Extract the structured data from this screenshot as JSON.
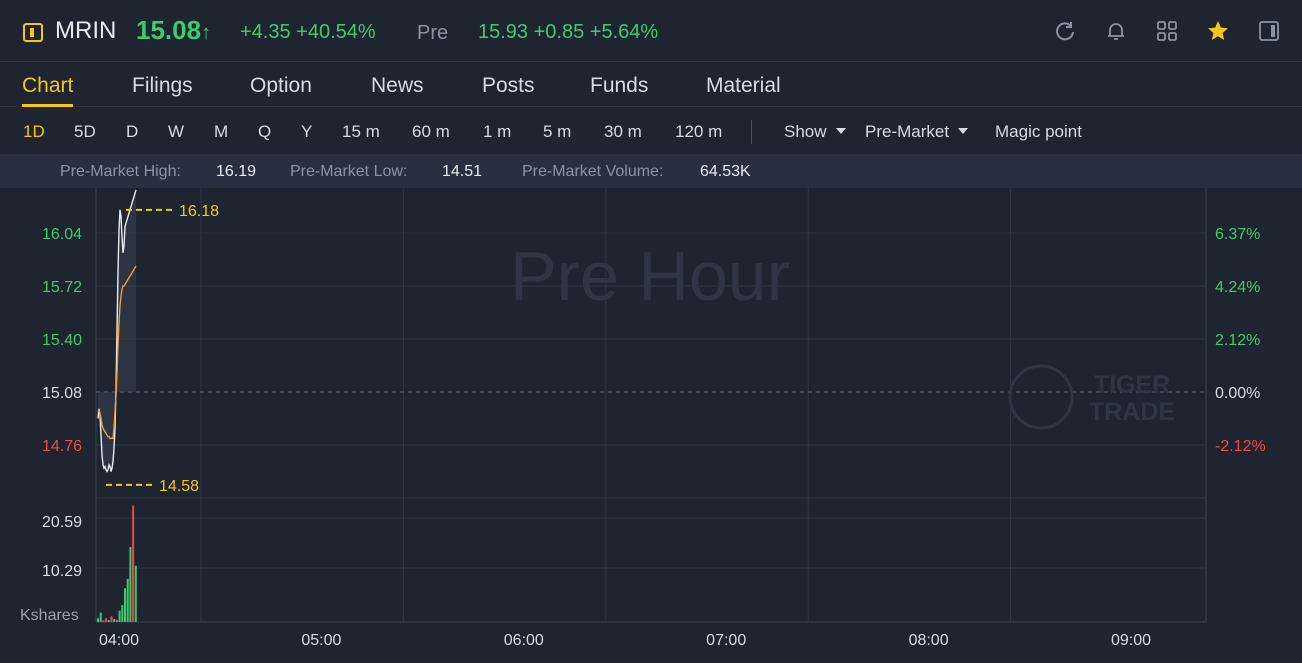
{
  "header": {
    "symbol": "MRIN",
    "price": "15.08",
    "price_arrow": "↑",
    "change": "+4.35 +40.54%",
    "pre_label": "Pre",
    "pre_values": "15.93 +0.85 +5.64%",
    "icons": [
      "refresh-icon",
      "bell-icon",
      "grid-icon",
      "star-icon",
      "panel-icon"
    ]
  },
  "tabs": [
    {
      "label": "Chart",
      "active": true
    },
    {
      "label": "Filings"
    },
    {
      "label": "Option"
    },
    {
      "label": "News"
    },
    {
      "label": "Posts"
    },
    {
      "label": "Funds"
    },
    {
      "label": "Material"
    }
  ],
  "periods": [
    "1D",
    "5D",
    "D",
    "W",
    "M",
    "Q",
    "Y",
    "15 m",
    "60 m",
    "1 m",
    "5 m",
    "30 m",
    "120 m"
  ],
  "dropdowns": {
    "show": "Show",
    "session": "Pre-Market",
    "magic": "Magic point"
  },
  "stats": {
    "high_label": "Pre-Market High:",
    "high": "16.19",
    "low_label": "Pre-Market Low:",
    "low": "14.51",
    "volume_label": "Pre-Market Volume:",
    "volume": "64.53K"
  },
  "watermark": {
    "main": "Pre Hour",
    "brand_line1": "TIGER",
    "brand_line2": "TRADE"
  },
  "colors": {
    "up": "#3ecb6a",
    "down": "#f0474b",
    "accent": "#f5c518"
  },
  "chart_data": {
    "type": "line",
    "price_ticks": [
      "16.04",
      "15.72",
      "15.40",
      "15.08",
      "14.76"
    ],
    "percent_ticks": [
      "6.37%",
      "4.24%",
      "2.12%",
      "0.00%",
      "-2.12%"
    ],
    "prev_close": 15.08,
    "price_range": [
      14.44,
      16.3
    ],
    "time_labels": [
      "04:00",
      "05:00",
      "06:00",
      "07:00",
      "08:00",
      "09:00"
    ],
    "high_marker": "16.18",
    "low_marker": "14.58",
    "series": [
      {
        "name": "",
        "color": "#e8ebf0",
        "x": [
          0,
          1,
          2,
          3,
          4,
          5,
          6,
          7,
          8,
          9,
          10,
          11,
          12,
          13,
          14,
          15,
          16,
          17,
          18,
          19,
          20,
          21,
          22,
          23,
          24,
          25,
          26,
          27,
          28,
          29,
          30,
          31,
          32,
          33,
          34,
          35,
          36,
          37,
          38
        ],
        "values": [
          14.92,
          14.98,
          14.94,
          14.82,
          14.7,
          14.64,
          14.62,
          14.63,
          14.61,
          14.6,
          14.61,
          14.64,
          14.63,
          14.6,
          14.62,
          14.66,
          14.74,
          14.86,
          15.1,
          15.45,
          15.8,
          16.06,
          16.18,
          16.14,
          16.02,
          15.92,
          15.96,
          16.08,
          16.1,
          16.12,
          16.14,
          16.16,
          16.18,
          16.2,
          16.22,
          16.24,
          16.26,
          16.28,
          16.3
        ]
      },
      {
        "name": "",
        "color": "#f0a030",
        "x": [
          0,
          1,
          2,
          3,
          4,
          5,
          6,
          7,
          8,
          9,
          10,
          11,
          12,
          13,
          14,
          15,
          16,
          17,
          18,
          19,
          20,
          21,
          22,
          23,
          24,
          25,
          26,
          27,
          28,
          29,
          30,
          31,
          32,
          33,
          34,
          35,
          36,
          37,
          38
        ],
        "values": [
          14.96,
          14.97,
          14.95,
          14.92,
          14.88,
          14.86,
          14.85,
          14.84,
          14.83,
          14.82,
          14.81,
          14.81,
          14.8,
          14.8,
          14.8,
          14.8,
          14.86,
          14.96,
          15.06,
          15.2,
          15.36,
          15.5,
          15.6,
          15.66,
          15.7,
          15.72,
          15.72,
          15.73,
          15.74,
          15.75,
          15.76,
          15.77,
          15.78,
          15.79,
          15.8,
          15.81,
          15.82,
          15.83,
          15.84
        ]
      }
    ],
    "volume": {
      "ticks": [
        "20.59",
        "10.29"
      ],
      "unit_label": "Kshares",
      "max": 30.9,
      "bars": [
        1.0,
        2.5,
        0.5,
        1.0,
        0.5,
        1.5,
        0.8,
        0.6,
        3.0,
        4.5,
        9.0,
        11.5,
        20.0,
        31.0,
        15.0
      ],
      "bar_colors": [
        "up",
        "up",
        "down",
        "down",
        "up",
        "down",
        "up",
        "down",
        "up",
        "up",
        "up",
        "up",
        "up",
        "down",
        "up"
      ]
    }
  }
}
